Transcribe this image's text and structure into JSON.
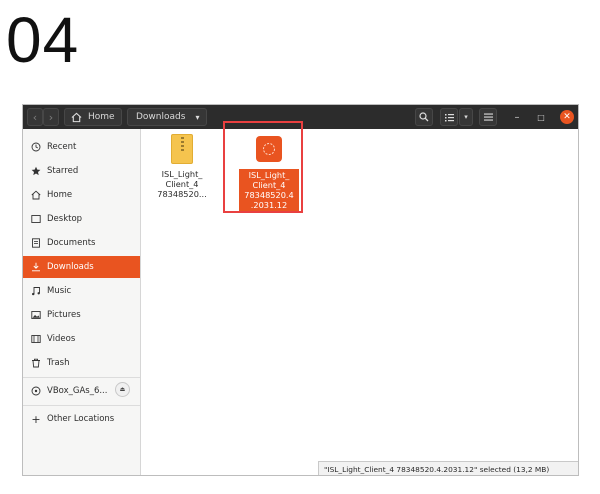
{
  "step": {
    "number": "04"
  },
  "headerbar": {
    "back_glyph": "‹",
    "forward_glyph": "›",
    "breadcrumbs": [
      "Home",
      "Downloads"
    ],
    "caret_glyph": "▾",
    "search_icon": "search-icon",
    "view_icon": "list-view-icon",
    "menu_icon": "hamburger-menu-icon",
    "minimize_glyph": "–",
    "maximize_glyph": "□",
    "close_glyph": "✕"
  },
  "sidebar": {
    "items": [
      {
        "label": "Recent",
        "icon": "clock-icon"
      },
      {
        "label": "Starred",
        "icon": "star-icon"
      },
      {
        "label": "Home",
        "icon": "home-icon"
      },
      {
        "label": "Desktop",
        "icon": "desktop-icon"
      },
      {
        "label": "Documents",
        "icon": "document-icon"
      },
      {
        "label": "Downloads",
        "icon": "download-icon",
        "active": true
      },
      {
        "label": "Music",
        "icon": "music-icon"
      },
      {
        "label": "Pictures",
        "icon": "picture-icon"
      },
      {
        "label": "Videos",
        "icon": "video-icon"
      },
      {
        "label": "Trash",
        "icon": "trash-icon"
      }
    ],
    "device": {
      "label": "VBox_GAs_6...",
      "icon": "disc-icon",
      "eject_glyph": "⏏"
    },
    "other_locations": {
      "label": "Other Locations",
      "glyph": "+"
    }
  },
  "files": [
    {
      "name_lines": [
        "ISL_Light_",
        "Client_4",
        "78348520..."
      ],
      "icon": "archive-icon",
      "selected": false
    },
    {
      "name_lines": [
        "ISL_Light_",
        "Client_4",
        "78348520.4",
        ".2031.12"
      ],
      "icon": "package-icon",
      "selected": true
    }
  ],
  "status": {
    "text": "\"ISL_Light_Client_4 78348520.4.2031.12\" selected (13,2 MB)"
  },
  "colors": {
    "accent": "#e95420",
    "highlight": "#e94040",
    "headerbar": "#2c2c2c"
  }
}
